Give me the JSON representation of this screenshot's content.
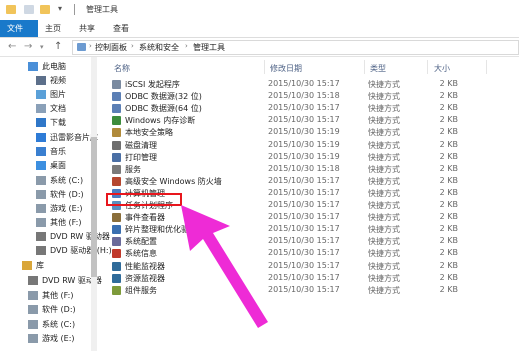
{
  "window": {
    "title": "管理工具"
  },
  "ribbon": {
    "tabs": [
      "文件",
      "主页",
      "共享",
      "查看"
    ]
  },
  "address": {
    "crumbs": [
      "控制面板",
      "系统和安全",
      "管理工具"
    ]
  },
  "columns": {
    "name": "名称",
    "date": "修改日期",
    "type": "类型",
    "size": "大小"
  },
  "sidebar": {
    "items": [
      {
        "label": "此电脑",
        "icon": "computer-icon"
      },
      {
        "label": "视频",
        "icon": "video-icon"
      },
      {
        "label": "图片",
        "icon": "picture-icon"
      },
      {
        "label": "文档",
        "icon": "document-icon"
      },
      {
        "label": "下载",
        "icon": "download-icon"
      },
      {
        "label": "迅雷影音片库",
        "icon": "media-library-icon"
      },
      {
        "label": "音乐",
        "icon": "music-icon"
      },
      {
        "label": "桌面",
        "icon": "desktop-icon"
      },
      {
        "label": "系统 (C:)",
        "icon": "drive-icon"
      },
      {
        "label": "软件 (D:)",
        "icon": "drive-icon"
      },
      {
        "label": "游戏 (E:)",
        "icon": "drive-icon"
      },
      {
        "label": "其他 (F:)",
        "icon": "drive-icon"
      },
      {
        "label": "DVD RW 驱动器",
        "icon": "dvd-icon"
      },
      {
        "label": "DVD 驱动器 (H:)",
        "icon": "dvd-icon"
      },
      {
        "label": "库",
        "icon": "library-icon"
      },
      {
        "label": "DVD RW 驱动器",
        "icon": "dvd-icon"
      },
      {
        "label": "其他 (F:)",
        "icon": "drive-icon"
      },
      {
        "label": "软件 (D:)",
        "icon": "drive-icon"
      },
      {
        "label": "系统 (C:)",
        "icon": "drive-icon"
      },
      {
        "label": "游戏 (E:)",
        "icon": "drive-icon"
      }
    ]
  },
  "files": [
    {
      "name": "iSCSI 发起程序",
      "date": "2015/10/30 15:17",
      "type": "快捷方式",
      "size": "2 KB",
      "color": "#7a8aa0"
    },
    {
      "name": "ODBC 数据源(32 位)",
      "date": "2015/10/30 15:18",
      "type": "快捷方式",
      "size": "2 KB",
      "color": "#5b7fb5"
    },
    {
      "name": "ODBC 数据源(64 位)",
      "date": "2015/10/30 15:17",
      "type": "快捷方式",
      "size": "2 KB",
      "color": "#5b7fb5"
    },
    {
      "name": "Windows 内存诊断",
      "date": "2015/10/30 15:17",
      "type": "快捷方式",
      "size": "2 KB",
      "color": "#3c8c3c"
    },
    {
      "name": "本地安全策略",
      "date": "2015/10/30 15:19",
      "type": "快捷方式",
      "size": "2 KB",
      "color": "#b08a3a"
    },
    {
      "name": "磁盘清理",
      "date": "2015/10/30 15:19",
      "type": "快捷方式",
      "size": "2 KB",
      "color": "#6e6e6e"
    },
    {
      "name": "打印管理",
      "date": "2015/10/30 15:19",
      "type": "快捷方式",
      "size": "2 KB",
      "color": "#4a6fa5"
    },
    {
      "name": "服务",
      "date": "2015/10/30 15:18",
      "type": "快捷方式",
      "size": "2 KB",
      "color": "#7a7a7a"
    },
    {
      "name": "高级安全 Windows 防火墙",
      "date": "2015/10/30 15:17",
      "type": "快捷方式",
      "size": "2 KB",
      "color": "#b5472f"
    },
    {
      "name": "计算机管理",
      "date": "2015/10/30 15:17",
      "type": "快捷方式",
      "size": "2 KB",
      "color": "#4b7cc1"
    },
    {
      "name": "任务计划程序",
      "date": "2015/10/30 15:17",
      "type": "快捷方式",
      "size": "2 KB",
      "color": "#5a8fc0"
    },
    {
      "name": "事件查看器",
      "date": "2015/10/30 15:17",
      "type": "快捷方式",
      "size": "2 KB",
      "color": "#8a6e3a"
    },
    {
      "name": "碎片整理和优化驱动器",
      "date": "2015/10/30 15:17",
      "type": "快捷方式",
      "size": "2 KB",
      "color": "#3a6fb0"
    },
    {
      "name": "系统配置",
      "date": "2015/10/30 15:17",
      "type": "快捷方式",
      "size": "2 KB",
      "color": "#6a6a9a"
    },
    {
      "name": "系统信息",
      "date": "2015/10/30 15:17",
      "type": "快捷方式",
      "size": "2 KB",
      "color": "#c0392b"
    },
    {
      "name": "性能监视器",
      "date": "2015/10/30 15:17",
      "type": "快捷方式",
      "size": "2 KB",
      "color": "#2f6b9a"
    },
    {
      "name": "资源监视器",
      "date": "2015/10/30 15:17",
      "type": "快捷方式",
      "size": "2 KB",
      "color": "#2f6b9a"
    },
    {
      "name": "组件服务",
      "date": "2015/10/30 15:17",
      "type": "快捷方式",
      "size": "2 KB",
      "color": "#7d9a3a"
    }
  ],
  "colors": {
    "accent": "#1979ca",
    "highlight_box": "#e8161d",
    "arrow": "#ee2bd6"
  }
}
